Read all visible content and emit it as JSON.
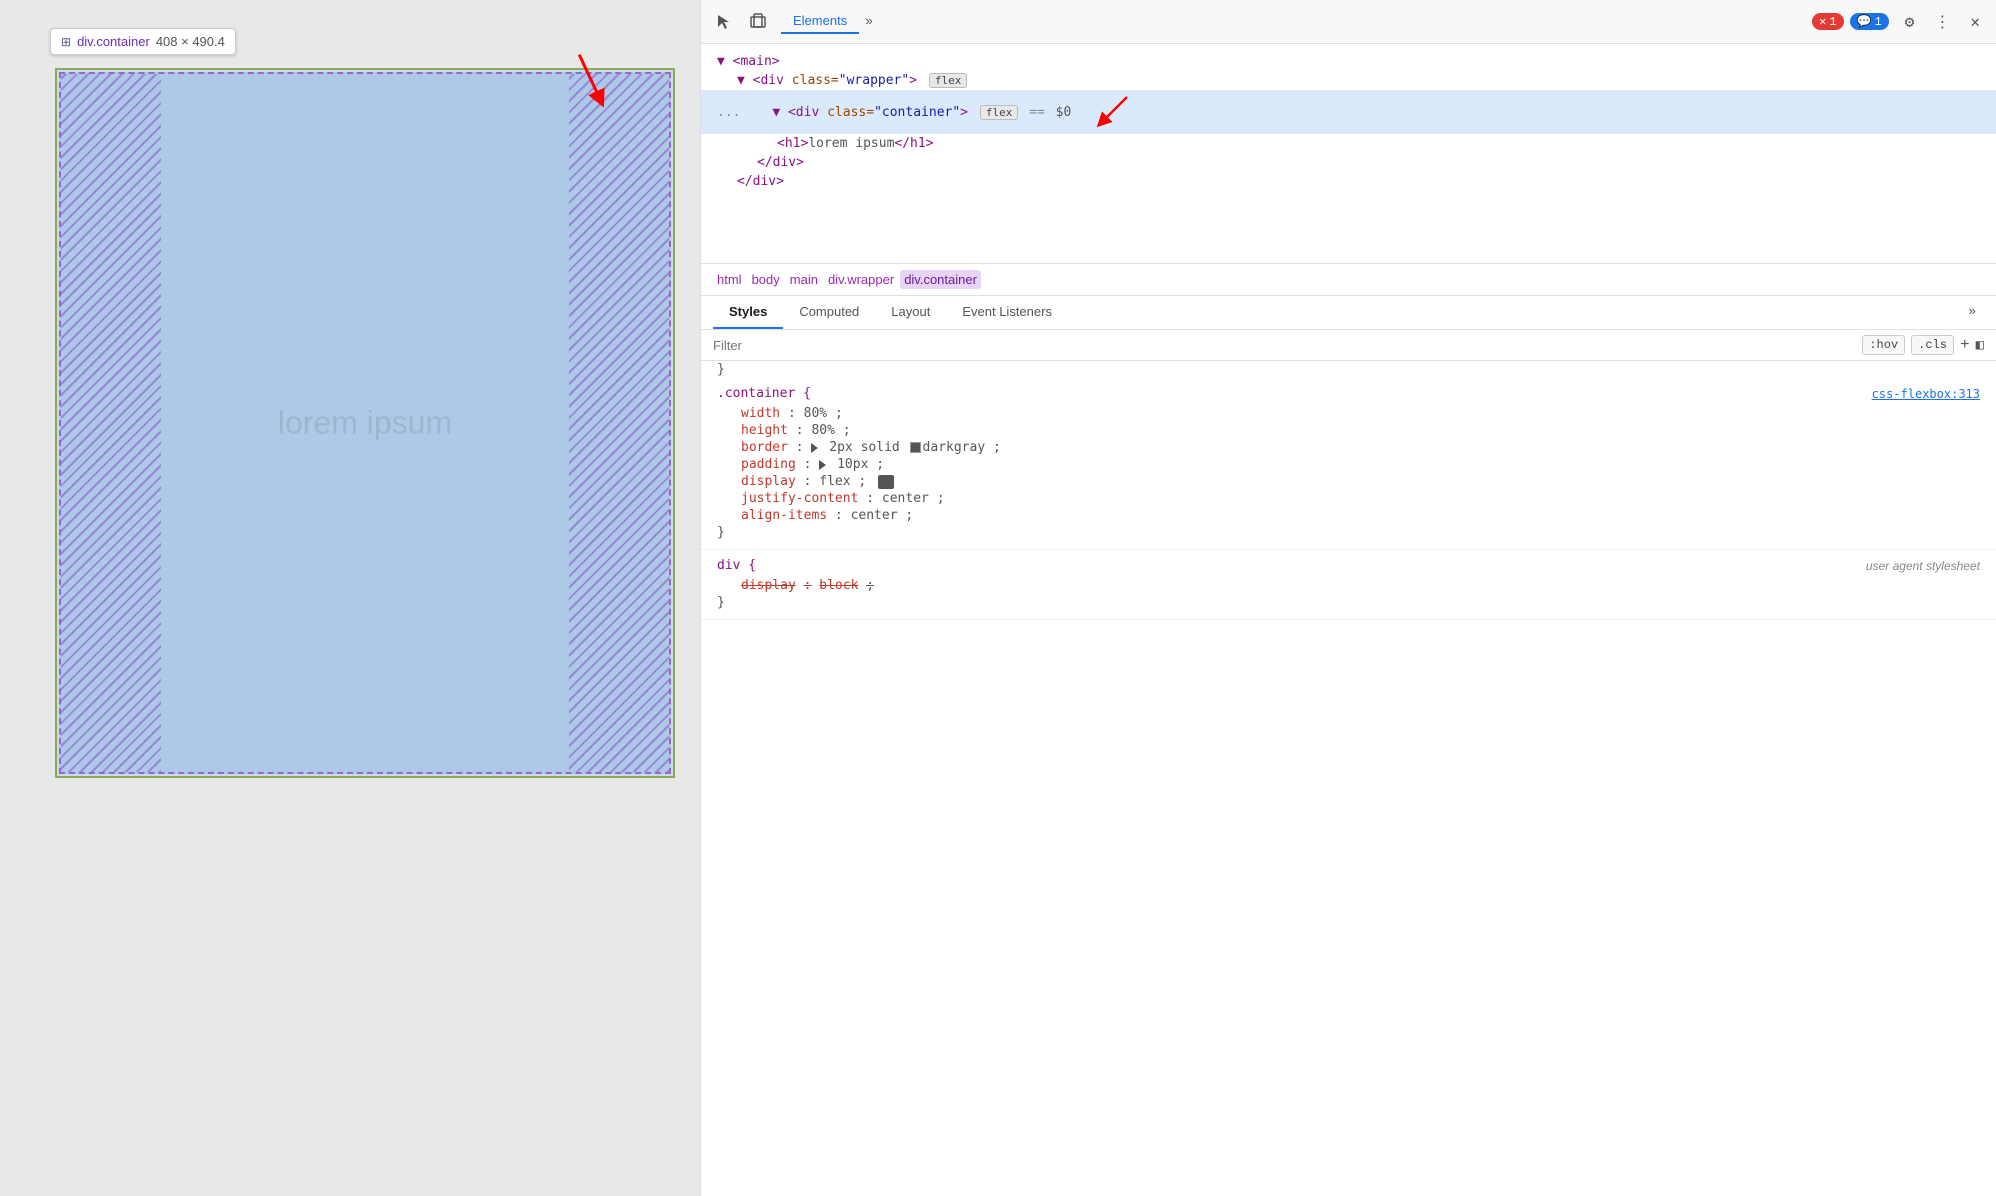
{
  "browser": {
    "tooltip": {
      "class": "div.container",
      "dims": "408 × 490.4"
    },
    "lorem": "lorem ipsum"
  },
  "devtools": {
    "toolbar": {
      "tabs": [
        "Elements"
      ],
      "more_label": "»",
      "badge_errors": "1",
      "badge_messages": "1"
    },
    "tree": {
      "lines": [
        {
          "indent": 0,
          "content": "▼ <main>"
        },
        {
          "indent": 1,
          "content": "▼ <div class=\"wrapper\">",
          "badge": "flex"
        },
        {
          "indent": 2,
          "content": "▼ <div class=\"container\">",
          "badge": "flex",
          "selected": true,
          "equals": "== $0"
        },
        {
          "indent": 3,
          "content": "<h1>lorem ipsum</h1>"
        },
        {
          "indent": 3,
          "content": "</div>"
        },
        {
          "indent": 2,
          "content": "</div>"
        }
      ]
    },
    "breadcrumb": {
      "items": [
        "html",
        "body",
        "main",
        "div.wrapper",
        "div.container"
      ]
    },
    "sub_tabs": {
      "tabs": [
        "Styles",
        "Computed",
        "Layout",
        "Event Listeners",
        "»"
      ]
    },
    "filter": {
      "placeholder": "Filter",
      "hov_label": ":hov",
      "cls_label": ".cls"
    },
    "css_rules": [
      {
        "selector": ".container {",
        "source": "css-flexbox:313",
        "props": [
          {
            "name": "width",
            "colon": ":",
            "value": " 80%;",
            "strikethrough": false,
            "hasColor": false,
            "hasTriangle": false,
            "hasFlexIcon": false
          },
          {
            "name": "height",
            "colon": ":",
            "value": " 80%;",
            "strikethrough": false,
            "hasColor": false,
            "hasTriangle": false,
            "hasFlexIcon": false
          },
          {
            "name": "border",
            "colon": ":",
            "value": " 2px solid  darkgray;",
            "strikethrough": false,
            "hasColor": true,
            "colorVal": "#555555",
            "hasTriangle": true,
            "hasFlexIcon": false
          },
          {
            "name": "padding",
            "colon": ":",
            "value": " 10px;",
            "strikethrough": false,
            "hasColor": false,
            "hasTriangle": true,
            "hasFlexIcon": false
          },
          {
            "name": "display",
            "colon": ":",
            "value": " flex;",
            "strikethrough": false,
            "hasColor": false,
            "hasTriangle": false,
            "hasFlexIcon": true
          },
          {
            "name": "justify-content",
            "colon": ":",
            "value": " center;",
            "strikethrough": false,
            "hasColor": false,
            "hasTriangle": false,
            "hasFlexIcon": false
          },
          {
            "name": "align-items",
            "colon": ":",
            "value": " center;",
            "strikethrough": false,
            "hasColor": false,
            "hasTriangle": false,
            "hasFlexIcon": false
          }
        ],
        "close": "}"
      },
      {
        "selector": "div {",
        "source": "user agent stylesheet",
        "source_italic": true,
        "props": [
          {
            "name": "display",
            "colon": ":",
            "value": " block;",
            "strikethrough": true,
            "hasColor": false,
            "hasTriangle": false,
            "hasFlexIcon": false
          }
        ],
        "close": "}"
      }
    ]
  }
}
